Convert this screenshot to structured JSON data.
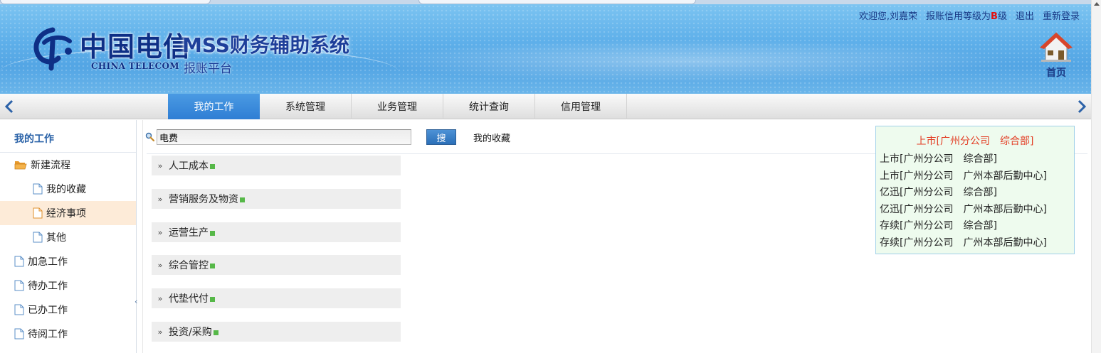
{
  "header": {
    "logo_cn": "中国电信",
    "logo_en": "CHINA TELECOM",
    "system_title": "MSS财务辅助系统",
    "system_subtitle": "报账平台",
    "welcome": "欢迎您,刘嘉荣",
    "credit_prefix": "报账信用等级为",
    "credit_grade": "B",
    "credit_suffix": "级",
    "logout": "退出",
    "relogin": "重新登录",
    "home_label": "首页"
  },
  "nav": {
    "tabs": [
      {
        "label": "我的工作",
        "active": true
      },
      {
        "label": "系统管理",
        "active": false
      },
      {
        "label": "业务管理",
        "active": false
      },
      {
        "label": "统计查询",
        "active": false
      },
      {
        "label": "信用管理",
        "active": false
      }
    ]
  },
  "sidebar": {
    "title": "我的工作",
    "items": [
      {
        "label": "新建流程",
        "level": 1,
        "icon": "folder-open-icon"
      },
      {
        "label": "我的收藏",
        "level": 2,
        "icon": "document-icon"
      },
      {
        "label": "经济事项",
        "level": 2,
        "icon": "document-icon",
        "selected": true
      },
      {
        "label": "其他",
        "level": 2,
        "icon": "document-icon"
      },
      {
        "label": "加急工作",
        "level": 1,
        "icon": "document-icon"
      },
      {
        "label": "待办工作",
        "level": 1,
        "icon": "document-icon"
      },
      {
        "label": "已办工作",
        "level": 1,
        "icon": "document-icon"
      },
      {
        "label": "待阅工作",
        "level": 1,
        "icon": "document-icon"
      }
    ]
  },
  "search": {
    "value": "电费",
    "button_label": "搜",
    "favorites_label": "我的收藏"
  },
  "categories": [
    "人工成本",
    "营销服务及物资",
    "运营生产",
    "综合管控",
    "代垫代付",
    "投资/采购"
  ],
  "org_selector": {
    "current": "上市[广州分公司　综合部]",
    "options": [
      "上市[广州分公司　综合部]",
      "上市[广州分公司　广州本部后勤中心]",
      "亿迅[广州分公司　综合部]",
      "亿迅[广州分公司　广州本部后勤中心]",
      "存续[广州分公司　综合部]",
      "存续[广州分公司　广州本部后勤中心]"
    ]
  },
  "colors": {
    "banner": "#5fb0ea",
    "nav_active": "#2f7ed4",
    "sidebar_selected": "#fdebd8",
    "org_current": "#e33d24",
    "credit_grade": "#e41010"
  }
}
